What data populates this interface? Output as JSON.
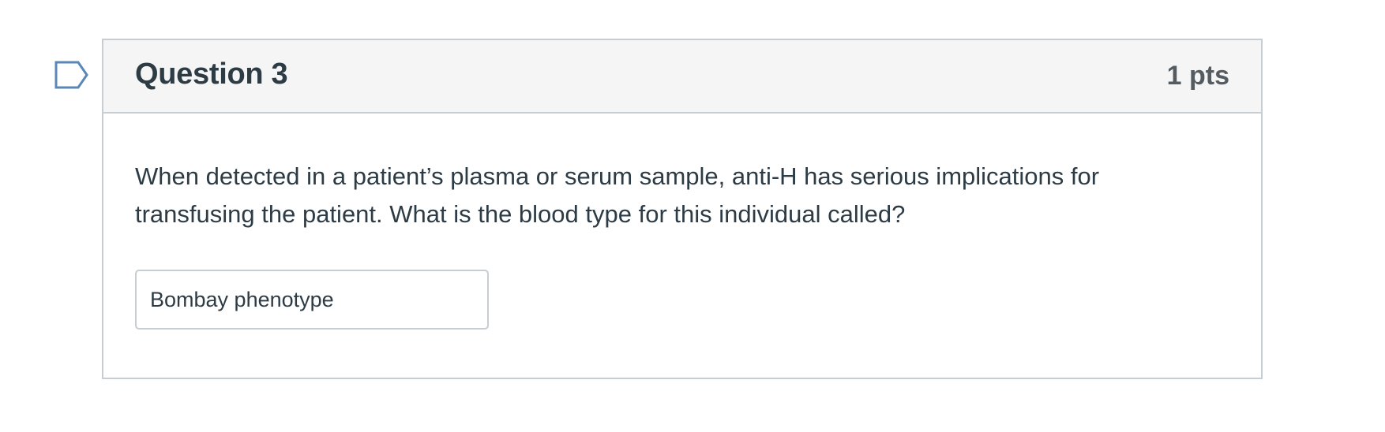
{
  "flag": {
    "icon": "flag-question-icon",
    "color": "#5a87b6"
  },
  "question": {
    "title": "Question 3",
    "points": "1 pts",
    "text": "When detected in a patient’s plasma or serum sample, anti-H has serious implications for transfusing the patient. What is the blood type for this individual called?",
    "answer_value": "Bombay phenotype"
  },
  "colors": {
    "header_bg": "#f5f5f5",
    "border": "#c7cdd1",
    "text": "#2d3b45",
    "points_text": "#555c61"
  }
}
